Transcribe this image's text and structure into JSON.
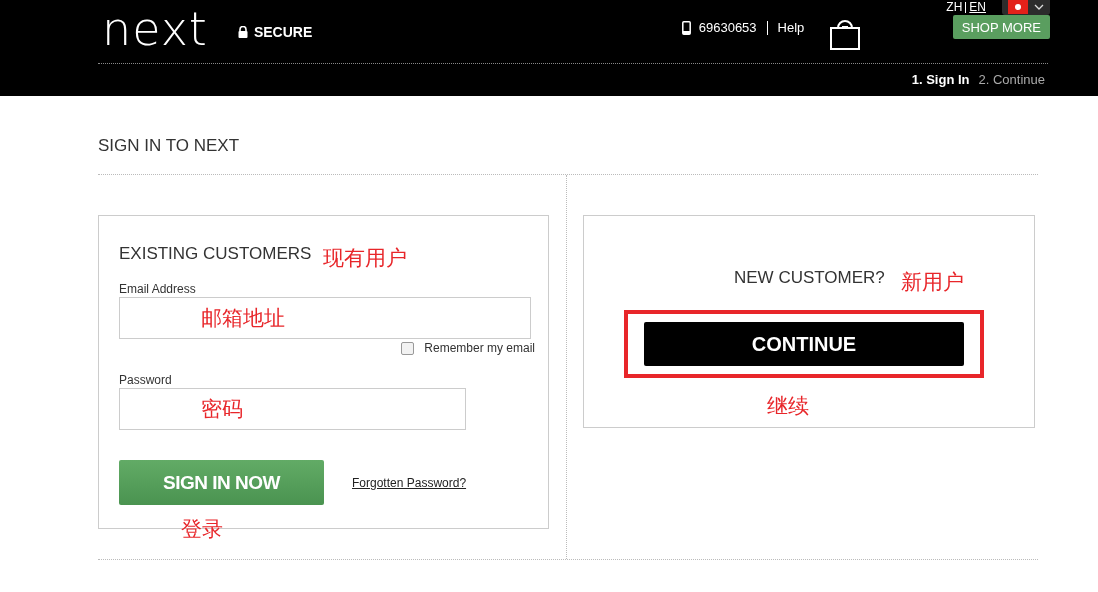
{
  "header": {
    "logo": "next",
    "secure": "SECURE",
    "phone": "69630653",
    "help": "Help",
    "languages": [
      {
        "label": "ZH",
        "selected": false
      },
      {
        "label": "EN",
        "selected": true
      }
    ],
    "shop_more": "SHOP MORE",
    "steps": [
      {
        "label": "1. Sign In",
        "selected": true
      },
      {
        "label": "2. Continue",
        "selected": false
      }
    ]
  },
  "page_title": "SIGN IN TO NEXT",
  "existing": {
    "heading": "EXISTING CUSTOMERS",
    "note": "现有用户",
    "email_label": "Email Address",
    "email_note": "邮箱地址",
    "remember": {
      "label": "Remember my email",
      "checked": false
    },
    "password_label": "Password",
    "password_note": "密码",
    "sign_in": "SIGN IN NOW",
    "sign_in_note": "登录",
    "forgot": "Forgotten Password?"
  },
  "new_customer": {
    "heading": "NEW CUSTOMER?",
    "note": "新用户",
    "continue": "CONTINUE",
    "continue_note": "继续"
  }
}
